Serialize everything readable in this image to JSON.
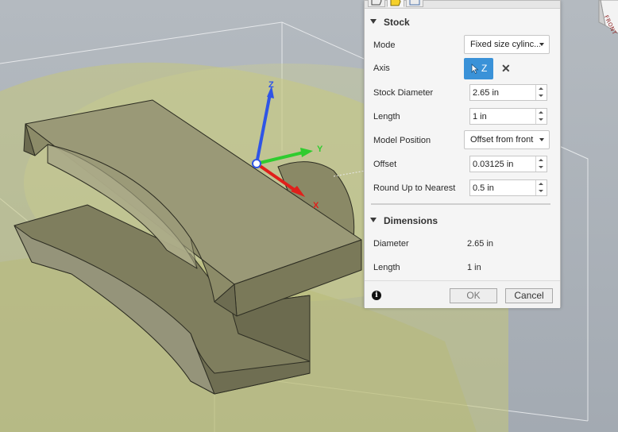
{
  "viewport": {
    "gizmo": {
      "z_label": "Z",
      "y_label": "Y",
      "x_label": "X"
    },
    "viewcube_label": "FRONT",
    "colors": {
      "background": "#a9b0b7",
      "part": "#8e8d6a",
      "stock": "#c5c77c",
      "axis_x": "#e0201b",
      "axis_y": "#2fcc2f",
      "axis_z": "#2f55e6"
    }
  },
  "panel": {
    "tabs": [
      {
        "icon": "pencil-tab-icon"
      },
      {
        "icon": "stock-tab-icon"
      },
      {
        "icon": "post-tab-icon"
      }
    ],
    "stock_section": {
      "title": "Stock",
      "mode_label": "Mode",
      "mode_value": "Fixed size cylinc...",
      "axis_label": "Axis",
      "axis_value": "Z",
      "stock_diameter_label": "Stock Diameter",
      "stock_diameter_value": "2.65 in",
      "length_label": "Length",
      "length_value": "1 in",
      "model_position_label": "Model Position",
      "model_position_value": "Offset from front",
      "offset_label": "Offset",
      "offset_value": "0.03125 in",
      "round_label": "Round Up to Nearest",
      "round_value": "0.5 in"
    },
    "dimensions_section": {
      "title": "Dimensions",
      "diameter_label": "Diameter",
      "diameter_value": "2.65 in",
      "length_label": "Length",
      "length_value": "1 in"
    },
    "footer": {
      "info": "i",
      "ok_label": "OK",
      "cancel_label": "Cancel"
    }
  }
}
